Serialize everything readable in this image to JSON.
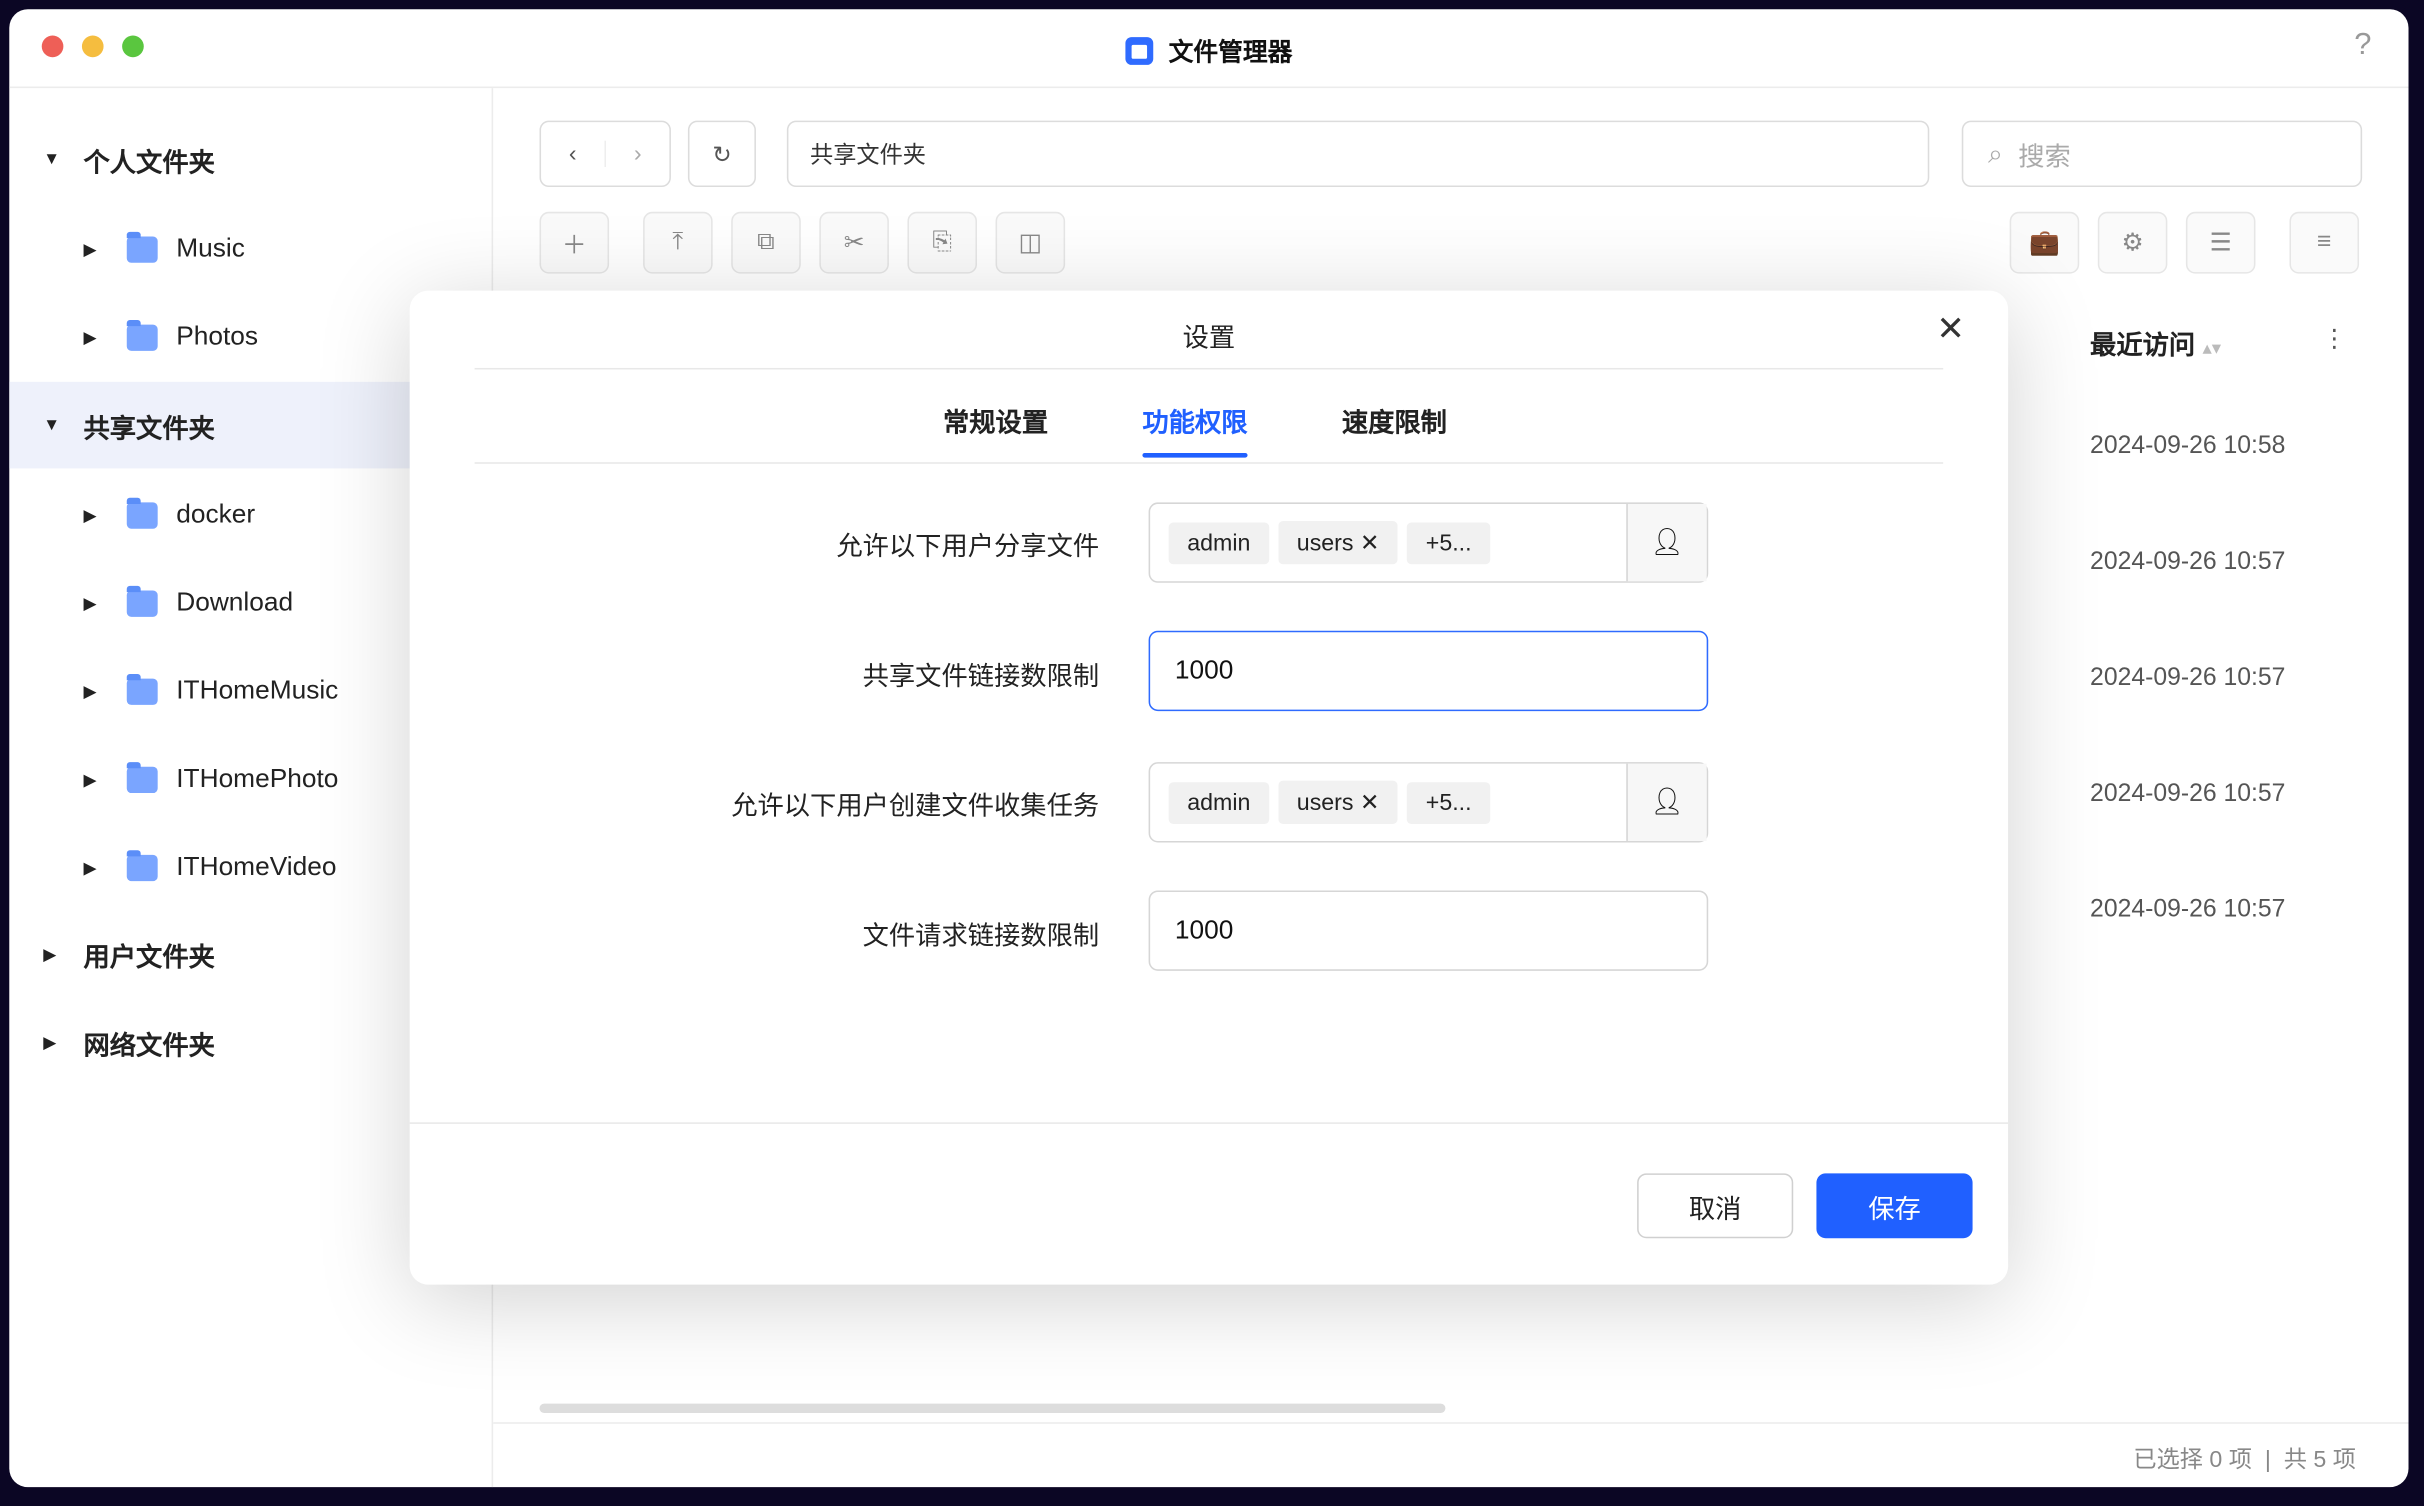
{
  "window": {
    "title": "文件管理器",
    "help": "?"
  },
  "sidebar": {
    "items": [
      {
        "label": "个人文件夹",
        "level": 0,
        "expanded": true
      },
      {
        "label": "Music",
        "level": 1
      },
      {
        "label": "Photos",
        "level": 1
      },
      {
        "label": "共享文件夹",
        "level": 0,
        "expanded": true,
        "selected": true
      },
      {
        "label": "docker",
        "level": 1
      },
      {
        "label": "Download",
        "level": 1
      },
      {
        "label": "ITHomeMusic",
        "level": 1
      },
      {
        "label": "ITHomePhoto",
        "level": 1
      },
      {
        "label": "ITHomeVideo",
        "level": 1
      },
      {
        "label": "用户文件夹",
        "level": 0
      },
      {
        "label": "网络文件夹",
        "level": 0
      }
    ]
  },
  "toolbar": {
    "path": "共享文件夹",
    "search_placeholder": "搜索"
  },
  "list": {
    "column_recent": "最近访问",
    "dates": [
      "2024-09-26 10:58",
      "2024-09-26 10:57",
      "2024-09-26 10:57",
      "2024-09-26 10:57",
      "2024-09-26 10:57"
    ]
  },
  "status": {
    "selected": "已选择 0 项",
    "sep": "|",
    "total": "共 5 项"
  },
  "dialog": {
    "title": "设置",
    "tabs": [
      "常规设置",
      "功能权限",
      "速度限制"
    ],
    "active_tab": 1,
    "fields": [
      {
        "label": "允许以下用户分享文件",
        "tags": [
          "admin",
          "users",
          "+5..."
        ]
      },
      {
        "label": "共享文件链接数限制",
        "value": "1000"
      },
      {
        "label": "允许以下用户创建文件收集任务",
        "tags": [
          "admin",
          "users",
          "+5..."
        ]
      },
      {
        "label": "文件请求链接数限制",
        "value": "1000"
      }
    ],
    "cancel": "取消",
    "save": "保存"
  },
  "colors": {
    "accent": "#2060ff"
  }
}
